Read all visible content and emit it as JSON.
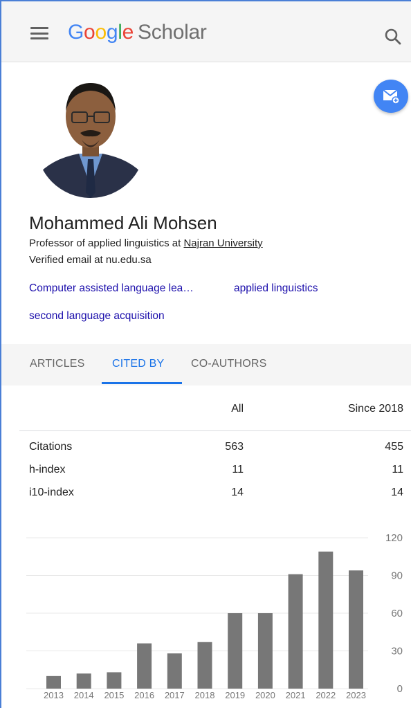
{
  "app": {
    "logo_google": [
      "G",
      "o",
      "o",
      "g",
      "l",
      "e"
    ],
    "logo_scholar": "Scholar"
  },
  "profile": {
    "name": "Mohammed Ali Mohsen",
    "affiliation_prefix": "Professor of applied linguistics at ",
    "affiliation_link": "Najran University",
    "email": "Verified email at nu.edu.sa",
    "interests": [
      "Computer assisted language lea…",
      "applied linguistics",
      "second language acquisition"
    ]
  },
  "tabs": {
    "articles": "ARTICLES",
    "cited_by": "CITED BY",
    "coauthors": "CO-AUTHORS",
    "active": "CITED BY"
  },
  "citations_table": {
    "columns": [
      "All",
      "Since 2018"
    ],
    "rows": [
      {
        "label": "Citations",
        "all": "563",
        "since": "455"
      },
      {
        "label": "h-index",
        "all": "11",
        "since": "11"
      },
      {
        "label": "i10-index",
        "all": "14",
        "since": "14"
      }
    ]
  },
  "colors": {
    "accent": "#1a73e8",
    "bar": "#777777",
    "fab": "#4285f4"
  },
  "chart_data": {
    "type": "bar",
    "categories": [
      "2013",
      "2014",
      "2015",
      "2016",
      "2017",
      "2018",
      "2019",
      "2020",
      "2021",
      "2022",
      "2023"
    ],
    "values": [
      10,
      12,
      13,
      36,
      28,
      37,
      60,
      60,
      91,
      109,
      94
    ],
    "title": "",
    "xlabel": "",
    "ylabel": "",
    "ylim": [
      0,
      120
    ],
    "yticks": [
      0,
      30,
      60,
      90,
      120
    ],
    "grid": true,
    "y_axis_side": "right"
  }
}
